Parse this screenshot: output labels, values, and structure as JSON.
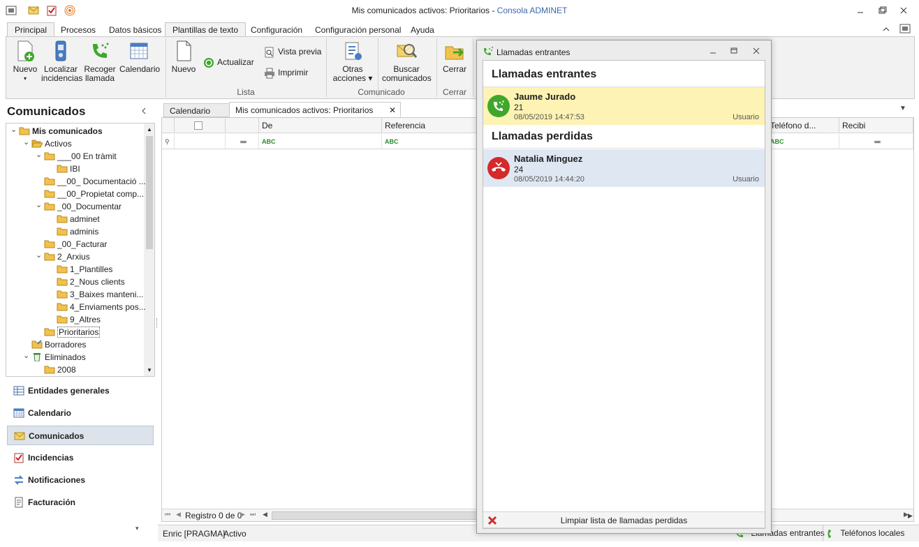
{
  "window": {
    "title_prefix": "Mis comunicados activos: Prioritarios - ",
    "title_app": "Consola ADMINET"
  },
  "menu": {
    "tabs": [
      "Principal",
      "Procesos",
      "Datos básicos",
      "Plantillas de texto",
      "Configuración",
      "Configuración personal",
      "Ayuda"
    ]
  },
  "ribbon": {
    "nuevo": "Nuevo",
    "localizar_1": "Localizar",
    "localizar_2": "incidencias",
    "recoger_1": "Recoger",
    "recoger_2": "llamada",
    "calendario": "Calendario",
    "nuevo2": "Nuevo",
    "actualizar": "Actualizar",
    "vista_previa": "Vista previa",
    "imprimir": "Imprimir",
    "otras_1": "Otras",
    "otras_2": "acciones",
    "buscar_1": "Buscar",
    "buscar_2": "comunicados",
    "cerrar": "Cerrar",
    "group_lista": "Lista",
    "group_comunicado": "Comunicado",
    "group_cerrar": "Cerrar"
  },
  "nav": {
    "title": "Comunicados",
    "tree": [
      {
        "label": "Mis comunicados",
        "bold": true
      },
      {
        "label": "Activos"
      },
      {
        "label": "___00 En tràmit"
      },
      {
        "label": "IBI"
      },
      {
        "label": "__00_ Documentació ..."
      },
      {
        "label": "__00_Propietat comp..."
      },
      {
        "label": "_00_Documentar"
      },
      {
        "label": "adminet"
      },
      {
        "label": "adminis"
      },
      {
        "label": "_00_Facturar"
      },
      {
        "label": "2_Arxius"
      },
      {
        "label": "1_Plantilles"
      },
      {
        "label": "2_Nous clients"
      },
      {
        "label": "3_Baixes manteni..."
      },
      {
        "label": "4_Enviaments pos..."
      },
      {
        "label": "9_Altres"
      },
      {
        "label": "Prioritarios"
      },
      {
        "label": "Borradores"
      },
      {
        "label": "Eliminados"
      },
      {
        "label": "2008"
      }
    ],
    "buttons": [
      "Entidades generales",
      "Calendario",
      "Comunicados",
      "Incidencias",
      "Notificaciones",
      "Facturación"
    ]
  },
  "doc_tabs": {
    "calendario": "Calendario",
    "active": "Mis comunicados activos: Prioritarios"
  },
  "grid": {
    "columns": {
      "de": "De",
      "referencia": "Referencia",
      "telefono": "Teléfono d...",
      "recibi": "Recibi"
    },
    "filter_abc": "ABC",
    "pager": "Registro 0 de 0"
  },
  "status": {
    "user": "Enric [PRAGMA]",
    "state": "Activo",
    "llamadas": "Llamadas entrantes",
    "telefonos": "Teléfonos locales"
  },
  "popup": {
    "title": "Llamadas entrantes",
    "incoming_header": "Llamadas entrantes",
    "missed_header": "Llamadas perdidas",
    "incoming": {
      "name": "Jaume Jurado",
      "number": "21",
      "datetime": "08/05/2019 14:47:53",
      "user": "Usuario"
    },
    "missed": {
      "name": "Natalia Minguez",
      "number": "24",
      "datetime": "08/05/2019 14:44:20",
      "user": "Usuario"
    },
    "clear_button": "Limpiar lista de llamadas perdidas"
  },
  "colors": {
    "incoming_row": "#fdf3b4",
    "missed_row": "#dfe8f2",
    "incoming_icon": "#3fa82b",
    "missed_icon": "#d42a2a",
    "app_title": "#3c67ad"
  }
}
